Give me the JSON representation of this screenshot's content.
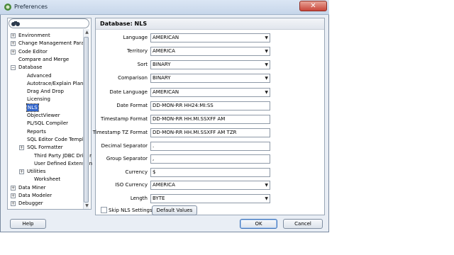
{
  "window": {
    "title": "Preferences",
    "close_symbol": "✕"
  },
  "search": {
    "placeholder": "",
    "icon": "binoculars-icon"
  },
  "tree": [
    {
      "label": "Environment",
      "expander": "+"
    },
    {
      "label": "Change Management Param",
      "expander": "+"
    },
    {
      "label": "Code Editor",
      "expander": "+"
    },
    {
      "label": "Compare and Merge",
      "expander": ""
    },
    {
      "label": "Database",
      "expander": "−"
    },
    {
      "label": "Advanced",
      "expander": ""
    },
    {
      "label": "Autotrace/Explain Plan",
      "expander": ""
    },
    {
      "label": "Drag And Drop",
      "expander": ""
    },
    {
      "label": "Licensing",
      "expander": ""
    },
    {
      "label": "NLS",
      "expander": "",
      "selected": true
    },
    {
      "label": "ObjectViewer",
      "expander": ""
    },
    {
      "label": "PL/SQL Compiler",
      "expander": ""
    },
    {
      "label": "Reports",
      "expander": ""
    },
    {
      "label": "SQL Editor Code Templa",
      "expander": ""
    },
    {
      "label": "SQL Formatter",
      "expander": "+"
    },
    {
      "label": "Third Party JDBC Driver",
      "expander": ""
    },
    {
      "label": "User Defined Extension",
      "expander": ""
    },
    {
      "label": "Utilities",
      "expander": "+"
    },
    {
      "label": "Worksheet",
      "expander": ""
    },
    {
      "label": "Data Miner",
      "expander": "+"
    },
    {
      "label": "Data Modeler",
      "expander": "+"
    },
    {
      "label": "Debugger",
      "expander": "+"
    }
  ],
  "panel": {
    "title": "Database: NLS"
  },
  "fields": [
    {
      "label": "Language",
      "value": "AMERICAN",
      "dropdown": true
    },
    {
      "label": "Territory",
      "value": "AMERICA",
      "dropdown": true
    },
    {
      "label": "Sort",
      "value": "BINARY",
      "dropdown": true
    },
    {
      "label": "Comparison",
      "value": "BINARY",
      "dropdown": true
    },
    {
      "label": "Date Language",
      "value": "AMERICAN",
      "dropdown": true
    },
    {
      "label": "Date Format",
      "value": "DD-MON-RR HH24:MI:SS",
      "dropdown": false
    },
    {
      "label": "Timestamp Format",
      "value": "DD-MON-RR HH.MI.SSXFF AM",
      "dropdown": false
    },
    {
      "label": "Timestamp TZ Format",
      "value": "DD-MON-RR HH.MI.SSXFF AM TZR",
      "dropdown": false
    },
    {
      "label": "Decimal Separator",
      "value": ".",
      "dropdown": false
    },
    {
      "label": "Group Separator",
      "value": ",",
      "dropdown": false
    },
    {
      "label": "Currency",
      "value": "$",
      "dropdown": false
    },
    {
      "label": "ISO Currency",
      "value": "AMERICA",
      "dropdown": true
    },
    {
      "label": "Length",
      "value": "BYTE",
      "dropdown": true
    }
  ],
  "skip_nls": {
    "label": "Skip NLS Settings",
    "checked": false
  },
  "buttons": {
    "default_values": "Default Values",
    "help": "Help",
    "ok": "OK",
    "cancel": "Cancel"
  },
  "colors": {
    "selection": "#3366cc",
    "accent": "#3d72b8"
  }
}
